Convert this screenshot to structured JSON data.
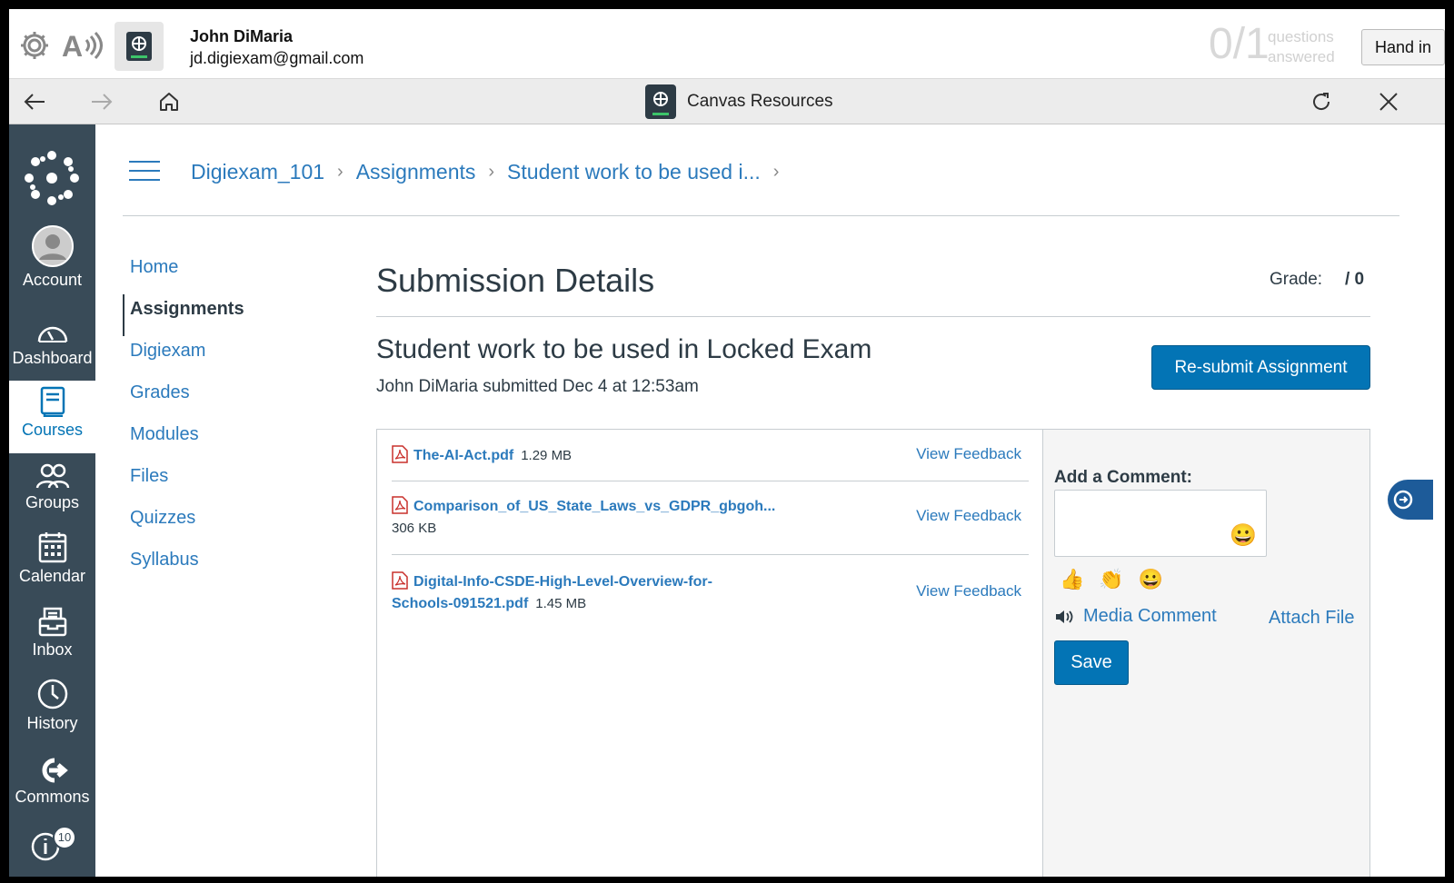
{
  "exam_bar": {
    "user_name": "John DiMaria",
    "user_email": "jd.digiexam@gmail.com",
    "questions_count": "0/1",
    "questions_label": "questions answered",
    "hand_in_label": "Hand in"
  },
  "browser": {
    "title": "Canvas Resources"
  },
  "global_nav": {
    "items": [
      {
        "label": "Account"
      },
      {
        "label": "Dashboard"
      },
      {
        "label": "Courses"
      },
      {
        "label": "Groups"
      },
      {
        "label": "Calendar"
      },
      {
        "label": "Inbox"
      },
      {
        "label": "History"
      },
      {
        "label": "Commons"
      }
    ],
    "help_badge": "10"
  },
  "breadcrumb": {
    "items": [
      "Digiexam_101",
      "Assignments",
      "Student work to be used i..."
    ]
  },
  "course_nav": {
    "items": [
      "Home",
      "Assignments",
      "Digiexam",
      "Grades",
      "Modules",
      "Files",
      "Quizzes",
      "Syllabus"
    ],
    "active": "Assignments"
  },
  "main": {
    "title": "Submission Details",
    "grade_label": "Grade:",
    "grade_value": "/ 0",
    "assignment_title": "Student work to be used in Locked Exam",
    "submitted_text": "John DiMaria submitted Dec 4 at 12:53am",
    "resubmit_label": "Re-submit Assignment"
  },
  "files": [
    {
      "name": "The-AI-Act.pdf",
      "size": "1.29 MB",
      "action": "View Feedback"
    },
    {
      "name": "Comparison_of_US_State_Laws_vs_GDPR_gbgoh...",
      "size": "306 KB",
      "action": "View Feedback"
    },
    {
      "name": "Digital-Info-CSDE-High-Level-Overview-for-Schools-091521.pdf",
      "size": "1.45 MB",
      "action": "View Feedback"
    }
  ],
  "comment": {
    "label": "Add a Comment:",
    "media_label": "Media Comment",
    "attach_label": "Attach File",
    "save_label": "Save"
  },
  "colors": {
    "brand_blue": "#0374b5",
    "link_blue": "#2b7abc",
    "nav_bg": "#394b58"
  }
}
